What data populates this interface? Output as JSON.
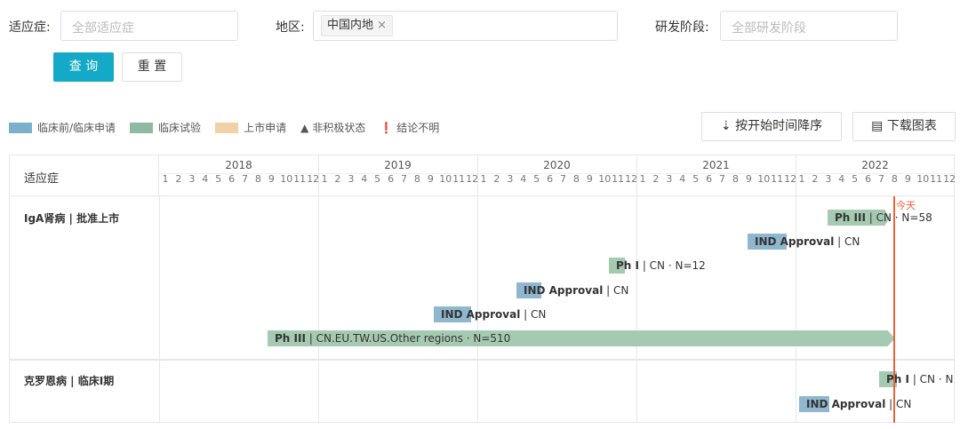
{
  "filters": {
    "indication_label": "适应症:",
    "indication_ph": "全部适应症",
    "region_label": "地区:",
    "region_tag": "中国内地",
    "stage_label": "研发阶段:",
    "stage_ph": "全部研发阶段"
  },
  "buttons": {
    "query": "查 询",
    "reset": "重 置",
    "sort": "按开始时间降序",
    "download": "下载图表"
  },
  "legend": [
    {
      "label": "临床前/临床申请",
      "color": "#7ab0c8"
    },
    {
      "label": "临床试验",
      "color": "#8fb9a0"
    },
    {
      "label": "上市申请",
      "color": "#f0d2a6"
    }
  ],
  "legend_extra": {
    "inactive": "非积极状态",
    "unclear": "结论不明"
  },
  "table": {
    "header": "适应症",
    "years": [
      "2018",
      "2019",
      "2020",
      "2021",
      "2022"
    ],
    "today": "今天"
  },
  "rows": [
    {
      "name": "IgA肾病 | 批准上市"
    },
    {
      "name": "克罗恩病 | 临床I期"
    }
  ],
  "bars": [
    {
      "label": "Ph III",
      "rest": "| CN · N=58"
    },
    {
      "label": "IND Approval",
      "rest": "| CN"
    },
    {
      "label": "Ph I",
      "rest": "| CN · N=12"
    },
    {
      "label": "IND Approval",
      "rest": "| CN"
    },
    {
      "label": "IND Approval",
      "rest": "| CN"
    },
    {
      "label": "Ph III",
      "rest": "| CN.EU.TW.US.Other regions · N=510"
    },
    {
      "label": "Ph I",
      "rest": "| CN · N"
    },
    {
      "label": "IND Approval",
      "rest": "| CN"
    }
  ]
}
